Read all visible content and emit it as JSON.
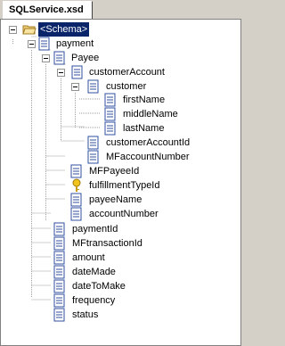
{
  "tab": {
    "label": "SQLService.xsd"
  },
  "tree": {
    "root": "<Schema>",
    "payment": "payment",
    "payee": "Payee",
    "customerAccount": "customerAccount",
    "customer": "customer",
    "firstName": "firstName",
    "middleName": "middleName",
    "lastName": "lastName",
    "customerAccountId": "customerAccountId",
    "mfAccountNumber": "MFaccountNumber",
    "mfPayeeId": "MFPayeeId",
    "fulfillmentTypeId": "fulfillmentTypeId",
    "payeeName": "payeeName",
    "accountNumber": "accountNumber",
    "paymentId": "paymentId",
    "mfTransactionId": "MFtransactionId",
    "amount": "amount",
    "dateMade": "dateMade",
    "dateToMake": "dateToMake",
    "frequency": "frequency",
    "status": "status"
  },
  "colors": {
    "selection": "#0a246a",
    "tree_line": "#a0a0a0",
    "icon_blue": "#2f4f9f"
  }
}
